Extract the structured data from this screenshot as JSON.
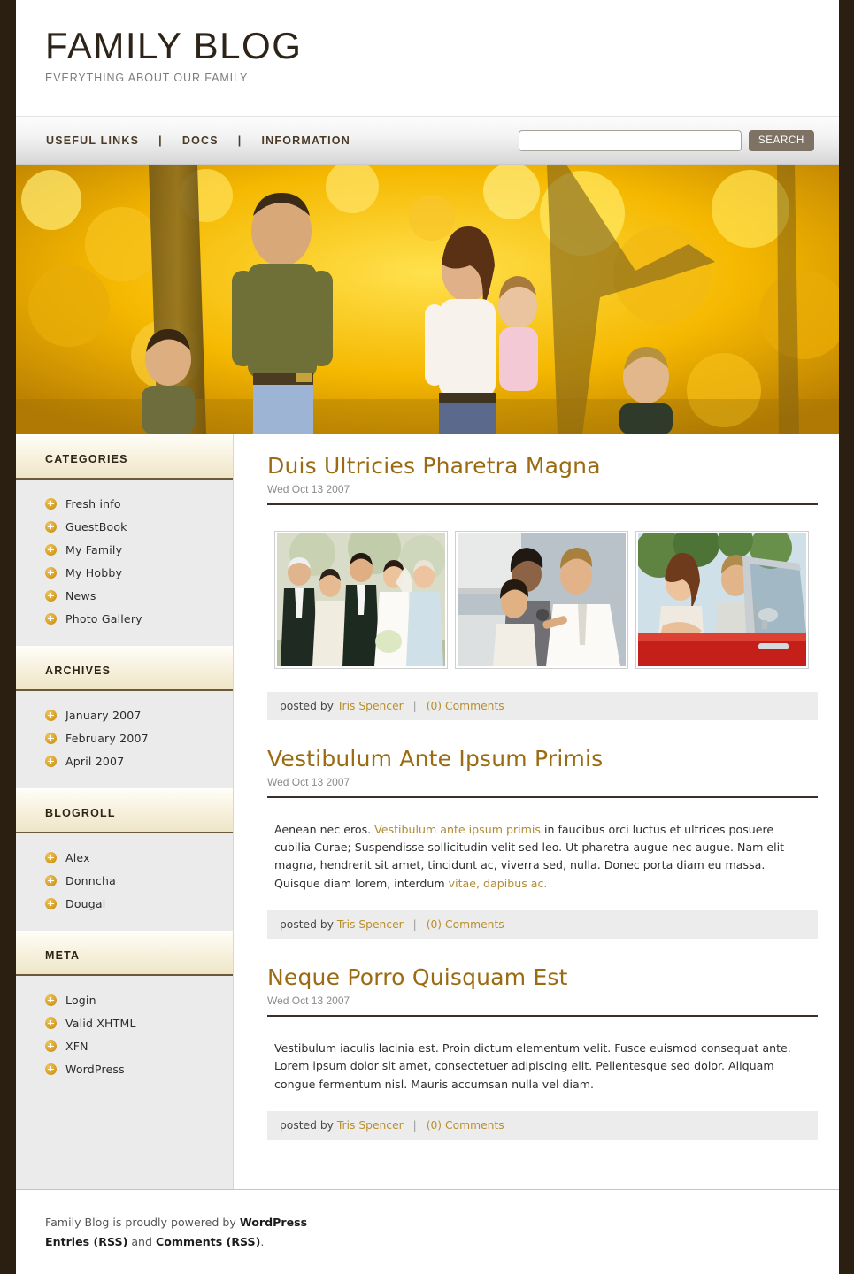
{
  "site": {
    "title": "FAMILY BLOG",
    "tagline": "EVERYTHING ABOUT OUR FAMILY"
  },
  "nav": {
    "items": [
      {
        "label": "USEFUL LINKS"
      },
      {
        "label": "DOCS"
      },
      {
        "label": "INFORMATION"
      }
    ],
    "separator": "|",
    "search": {
      "value": "",
      "placeholder": "",
      "button_label": "SEARCH"
    }
  },
  "banner": {
    "alt": "family-autumn-photo"
  },
  "sidebar": {
    "widgets": [
      {
        "title": "CATEGORIES",
        "items": [
          {
            "label": "Fresh info"
          },
          {
            "label": "GuestBook"
          },
          {
            "label": "My Family"
          },
          {
            "label": "My Hobby"
          },
          {
            "label": "News"
          },
          {
            "label": "Photo Gallery"
          }
        ]
      },
      {
        "title": "ARCHIVES",
        "items": [
          {
            "label": "January 2007"
          },
          {
            "label": "February 2007"
          },
          {
            "label": "April 2007"
          }
        ]
      },
      {
        "title": "BLOGROLL",
        "items": [
          {
            "label": "Alex"
          },
          {
            "label": "Donncha"
          },
          {
            "label": "Dougal"
          }
        ]
      },
      {
        "title": "META",
        "items": [
          {
            "label": "Login"
          },
          {
            "label": "Valid XHTML"
          },
          {
            "label": "XFN"
          },
          {
            "label": "WordPress"
          }
        ]
      }
    ]
  },
  "posts": [
    {
      "title": "Duis Ultricies Pharetra Magna",
      "date": "Wed Oct 13 2007",
      "thumbnails": [
        {
          "alt": "wedding-group-photo"
        },
        {
          "alt": "doctor-examining-child-photo"
        },
        {
          "alt": "couple-in-red-car-photo"
        }
      ],
      "meta": {
        "posted_by_label": "posted by",
        "author": "Tris Spencer",
        "separator": "|",
        "comments": "(0) Comments"
      }
    },
    {
      "title": "Vestibulum Ante Ipsum Primis",
      "date": "Wed Oct 13 2007",
      "body": {
        "part1": "Aenean nec eros. ",
        "link1": "Vestibulum ante ipsum primis",
        "part2": " in faucibus orci luctus et ultrices posuere cubilia Curae; Suspendisse sollicitudin velit sed leo. Ut pharetra augue nec augue. Nam elit magna, hendrerit sit amet, tincidunt ac, viverra sed, nulla. Donec porta diam eu massa. Quisque diam lorem, interdum ",
        "link2": "vitae, dapibus ac."
      },
      "meta": {
        "posted_by_label": "posted by",
        "author": "Tris Spencer",
        "separator": "|",
        "comments": "(0) Comments"
      }
    },
    {
      "title": "Neque Porro Quisquam Est",
      "date": "Wed Oct 13 2007",
      "body": {
        "part1": "Vestibulum iaculis lacinia est. Proin dictum elementum velit. Fusce euismod consequat ante. Lorem ipsum dolor sit amet, consectetuer adipiscing elit. Pellentesque sed dolor. Aliquam congue fermentum nisl. Mauris accumsan nulla vel diam."
      },
      "meta": {
        "posted_by_label": "posted by",
        "author": "Tris Spencer",
        "separator": "|",
        "comments": "(0) Comments"
      }
    }
  ],
  "footer": {
    "line1_prefix": "Family Blog is proudly powered by ",
    "wordpress": "WordPress",
    "entries_rss": "Entries (RSS)",
    "and": " and ",
    "comments_rss": "Comments (RSS)",
    "period": "."
  },
  "colors": {
    "page_background": "#2b1f12",
    "accent_gold": "#9a6b12",
    "link_gold": "#b98f2e",
    "bullet": "#d9a227",
    "search_button": "#7d7264",
    "sidebar_bg": "#ebebeb",
    "widget_title_bg": "#f6f0dc"
  }
}
